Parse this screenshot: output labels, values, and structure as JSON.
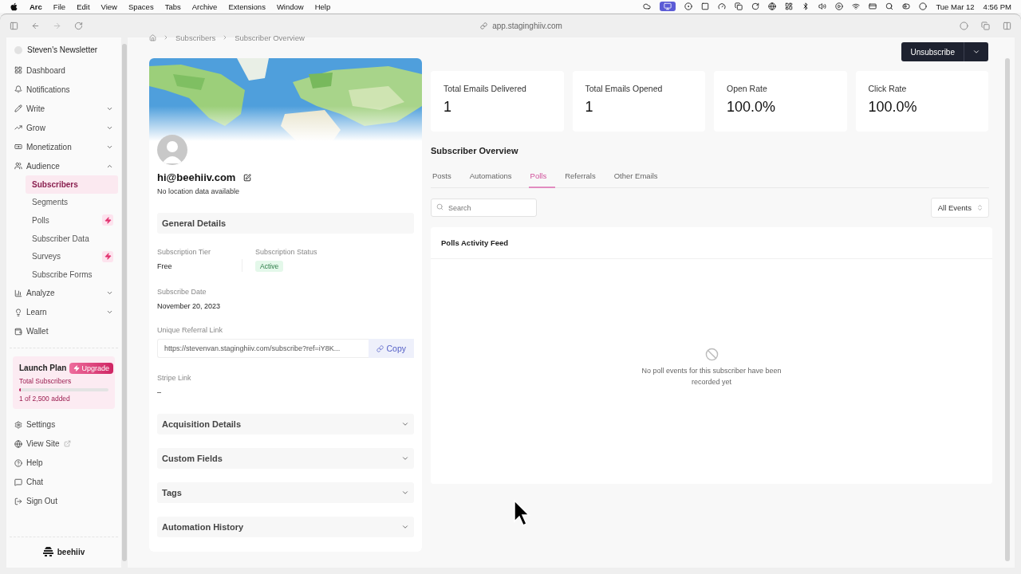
{
  "menubar": {
    "app": "Arc",
    "menus": [
      "File",
      "Edit",
      "View",
      "Spaces",
      "Tabs",
      "Archive",
      "Extensions",
      "Window",
      "Help"
    ],
    "date": "Tue Mar 12",
    "time": "4:56 PM"
  },
  "browser": {
    "url": "app.staginghiiv.com"
  },
  "sidebar": {
    "workspace": "Steven's Newsletter",
    "items": [
      {
        "label": "Dashboard"
      },
      {
        "label": "Notifications"
      },
      {
        "label": "Write",
        "expanded": false
      },
      {
        "label": "Grow",
        "expanded": false
      },
      {
        "label": "Monetization",
        "expanded": false
      },
      {
        "label": "Audience",
        "expanded": true,
        "children": [
          {
            "label": "Subscribers",
            "selected": true,
            "boost": false
          },
          {
            "label": "Segments",
            "selected": false,
            "boost": false
          },
          {
            "label": "Polls",
            "selected": false,
            "boost": true
          },
          {
            "label": "Subscriber Data",
            "selected": false,
            "boost": false
          },
          {
            "label": "Surveys",
            "selected": false,
            "boost": true
          },
          {
            "label": "Subscribe Forms",
            "selected": false,
            "boost": false
          }
        ]
      },
      {
        "label": "Analyze",
        "expanded": false
      },
      {
        "label": "Learn",
        "expanded": false
      },
      {
        "label": "Wallet"
      }
    ],
    "plan": {
      "title": "Launch Plan",
      "button": "Upgrade",
      "label": "Total Subscribers",
      "level": 0.004,
      "count": "1 of 2,500 added"
    },
    "footer_items": [
      {
        "label": "Settings",
        "external": false
      },
      {
        "label": "View Site",
        "external": true
      },
      {
        "label": "Help",
        "external": false
      },
      {
        "label": "Chat",
        "external": false
      },
      {
        "label": "Sign Out",
        "external": false
      }
    ],
    "brand": "beehiiv"
  },
  "breadcrumb": [
    "Subscribers",
    "Subscriber Overview"
  ],
  "header": {
    "button": "Unsubscribe"
  },
  "profile": {
    "email": "hi@beehiiv.com",
    "location": "No location data available",
    "details_title": "General Details",
    "tier_label": "Subscription Tier",
    "tier": "Free",
    "status_label": "Subscription Status",
    "status": "Active",
    "date_label": "Subscribe Date",
    "date": "November 20, 2023",
    "referral_label": "Unique Referral Link",
    "referral": "https://stevenvan.staginghiiv.com/subscribe?ref=iY8K...",
    "copy": "Copy",
    "stripe_label": "Stripe Link",
    "stripe": "–",
    "sections": [
      {
        "title": "Acquisition Details",
        "expanded": false
      },
      {
        "title": "Custom Fields",
        "expanded": false
      },
      {
        "title": "Tags",
        "expanded": false
      },
      {
        "title": "Automation History",
        "expanded": false
      }
    ]
  },
  "stats": [
    {
      "label": "Total Emails Delivered",
      "value": "1"
    },
    {
      "label": "Total Emails Opened",
      "value": "1"
    },
    {
      "label": "Open Rate",
      "value": "100.0%"
    },
    {
      "label": "Click Rate",
      "value": "100.0%"
    }
  ],
  "overview": {
    "title": "Subscriber Overview",
    "tabs": [
      {
        "label": "Posts",
        "selected": false
      },
      {
        "label": "Automations",
        "selected": false
      },
      {
        "label": "Polls",
        "selected": true
      },
      {
        "label": "Referrals",
        "selected": false
      },
      {
        "label": "Other Emails",
        "selected": false
      }
    ],
    "search": {
      "placeholder": "Search"
    },
    "filter": "All Events",
    "feed_title": "Polls Activity Feed",
    "empty": "No poll events for this subscriber have been recorded yet"
  }
}
